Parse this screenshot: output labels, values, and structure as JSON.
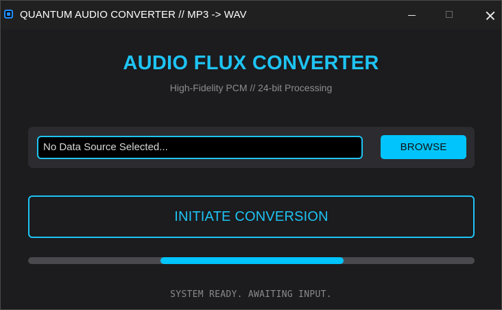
{
  "window": {
    "title": "QUANTUM AUDIO CONVERTER // MP3 -> WAV",
    "controls": {
      "minimize_icon": "minimize-icon",
      "maximize_icon": "maximize-icon",
      "close_icon": "close-icon"
    }
  },
  "header": {
    "title": "AUDIO FLUX CONVERTER",
    "subtitle": "High-Fidelity PCM // 24-bit Processing"
  },
  "file_select": {
    "value": "No Data Source Selected...",
    "browse_label": "BROWSE"
  },
  "actions": {
    "convert_label": "INITIATE CONVERSION"
  },
  "progress": {
    "segment_start": 0.297,
    "segment_end": 0.706
  },
  "status": {
    "text": "SYSTEM READY. AWAITING INPUT."
  },
  "colors": {
    "accent": "#1ec4f4",
    "button_fill": "#00c4fb",
    "background": "#1c1b1e",
    "panel": "#2c2b2f",
    "track": "#4a4a4e"
  }
}
